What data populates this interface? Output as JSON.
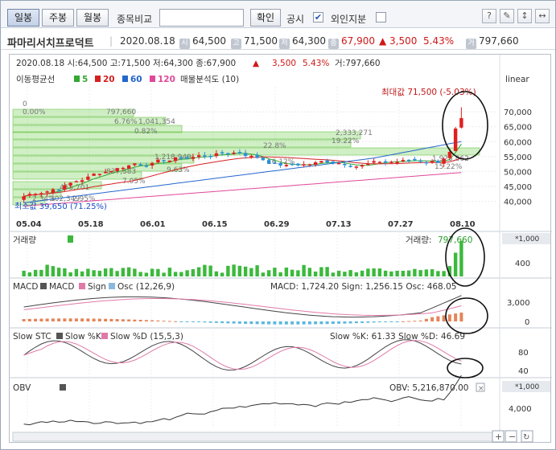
{
  "toolbar": {
    "tabs": [
      "일봉",
      "주봉",
      "월봉"
    ],
    "compare_label": "종목비교",
    "compare_value": "",
    "confirm_label": "확인",
    "notice_label": "공시",
    "notice_checked": "✔",
    "foreign_label": "외인지분",
    "icons": [
      "?",
      "✎",
      "↕",
      "↔"
    ]
  },
  "info": {
    "name": "파마리서치프로덕트",
    "date": "2020.08.18",
    "badge_open": "시",
    "open": "64,500",
    "badge_high": "고",
    "high": "71,500",
    "badge_low": "저",
    "low": "64,300",
    "badge_close": "종",
    "close": "67,900",
    "change": "▲ 3,500",
    "pct": "5.43%",
    "badge_vol": "거",
    "volume": "797,660"
  },
  "price_panel": {
    "header": "2020.08.18  시:64,500  고:71,500  저:64,300  종:67,900",
    "arrow": "▲",
    "change": "3,500",
    "pct": "5.43%",
    "vol": "거:797,660",
    "ma_label": "이동평균선",
    "ma": [
      {
        "n": "5",
        "color": "#33a833"
      },
      {
        "n": "20",
        "color": "#d42020"
      },
      {
        "n": "60",
        "color": "#2366cc"
      },
      {
        "n": "120",
        "color": "#e0489a"
      }
    ],
    "profile_label": "매물분석도 (10)",
    "scale": "linear",
    "max_note": "최대값 71,500 (-5.03%)",
    "min_note": "최소값 39,650 (71.25%)",
    "y_ticks": [
      "70,000",
      "65,000",
      "60,000",
      "55,000",
      "50,000",
      "45,000",
      "40,000"
    ],
    "x_ticks": [
      "05.04",
      "05.18",
      "06.01",
      "06.15",
      "06.29",
      "07.13",
      "07.27",
      "08.10"
    ],
    "profile_labels": [
      "0",
      "0.00%",
      "797,660",
      "6.76%",
      "1,041,354",
      "0.82%",
      "2,333,271",
      "19.22%",
      "22.8%",
      "16.12%",
      "1,218,949",
      "9.63%",
      "837,383",
      "7.05%",
      "455,701",
      "302,349",
      "2.95%",
      "2.34%",
      "1,925,862",
      "15.22%"
    ]
  },
  "volume_panel": {
    "title": "거래량",
    "value_label": "거래량:",
    "value": "797,660",
    "unit": "*1,000",
    "ticks": [
      "400"
    ]
  },
  "macd_panel": {
    "title": "MACD",
    "l1": "MACD",
    "l2": "Sign",
    "l3": "Osc (12,26,9)",
    "value_text": "MACD: 1,724.20  Sign: 1,256.15  Osc: 468.05",
    "ticks": [
      "3,000",
      "0"
    ]
  },
  "stc_panel": {
    "title": "Slow STC",
    "l1": "Slow %K",
    "l2": "Slow %D (15,5,3)",
    "value_text": "Slow %K: 61.33  Slow %D: 46.69",
    "ticks": [
      "80",
      "40"
    ]
  },
  "obv_panel": {
    "title": "OBV",
    "value_text": "OBV: 5,216,870.00",
    "unit": "*1,000",
    "ticks": [
      "4,000"
    ]
  },
  "colors": {
    "up": "#e02020",
    "down": "#2a8fd6",
    "vol": "#3cb93c",
    "ma5": "#33a833",
    "ma20": "#d42020",
    "ma60": "#2366cc",
    "ma120": "#e0489a"
  }
}
